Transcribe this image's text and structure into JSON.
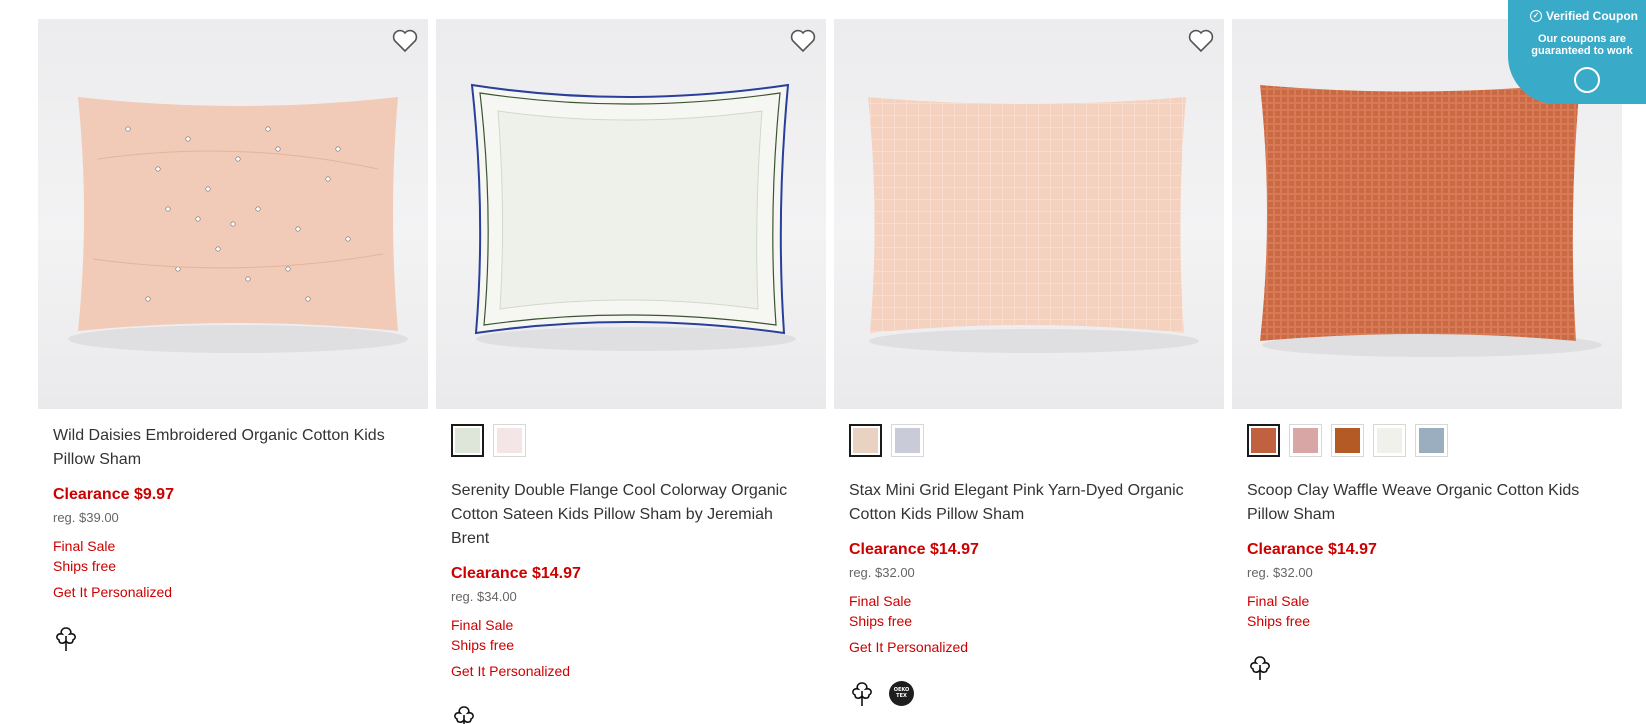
{
  "products": [
    {
      "name": "Wild Daisies Embroidered Organic Cotton Kids Pillow Sham",
      "price": "Clearance $9.97",
      "reg": "reg. $39.00",
      "final_sale": "Final Sale",
      "ships": "Ships free",
      "personalize": "Get It Personalized",
      "swatches": [],
      "pillow_color": "#f2cbb8",
      "badges": [
        "cotton-icon"
      ]
    },
    {
      "name": "Serenity Double Flange Cool Colorway Organic Cotton Sateen Kids Pillow Sham by Jeremiah Brent",
      "price": "Clearance $14.97",
      "reg": "reg. $34.00",
      "final_sale": "Final Sale",
      "ships": "Ships free",
      "personalize": "Get It Personalized",
      "swatches": [
        "#dde6d8",
        "#f4e6e6"
      ],
      "pillow_color": "#f1f3ee",
      "badges": [
        "cotton-icon"
      ]
    },
    {
      "name": "Stax Mini Grid Elegant Pink Yarn-Dyed Organic Cotton Kids Pillow Sham",
      "price": "Clearance $14.97",
      "reg": "reg. $32.00",
      "final_sale": "Final Sale",
      "ships": "Ships free",
      "personalize": "Get It Personalized",
      "swatches": [
        "#ead2c2",
        "#c9ccd8"
      ],
      "pillow_color": "#f5d2c0",
      "badges": [
        "cotton-icon",
        "oeko-tex-icon"
      ]
    },
    {
      "name": "Scoop Clay Waffle Weave Organic Cotton Kids Pillow Sham",
      "price": "Clearance $14.97",
      "reg": "reg. $32.00",
      "final_sale": "Final Sale",
      "ships": "Ships free",
      "personalize": "",
      "swatches": [
        "#c0613f",
        "#d9a6a6",
        "#b45a24",
        "#f1f1ec",
        "#9aaec0"
      ],
      "pillow_color": "#d77a55",
      "badges": [
        "cotton-icon"
      ]
    }
  ],
  "coupon": {
    "title": "Verified Coupon",
    "subtitle": "Our coupons are guaranteed to work"
  },
  "oeko_label": "OEKO TEX"
}
